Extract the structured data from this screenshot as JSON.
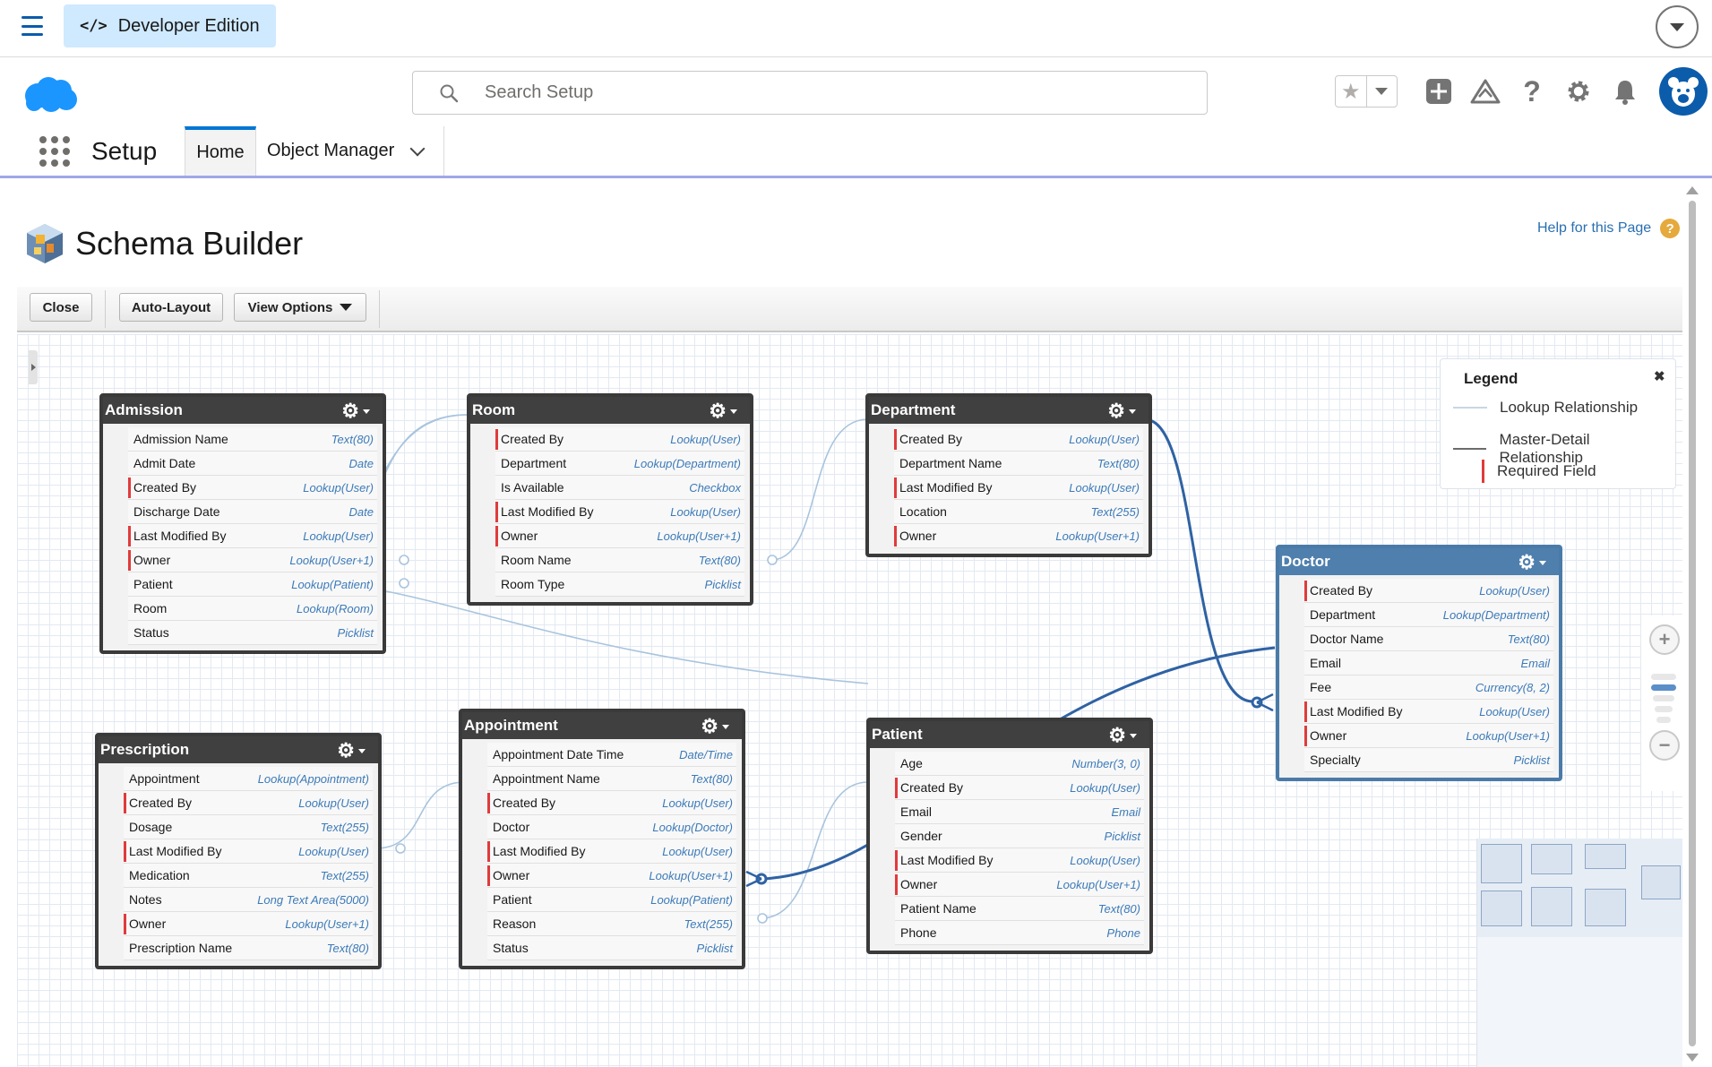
{
  "topbar": {
    "badge_label": "Developer Edition",
    "code_icon": "</>"
  },
  "search": {
    "placeholder": "Search Setup"
  },
  "nav": {
    "app_name": "Setup",
    "tabs": [
      {
        "label": "Home"
      },
      {
        "label": "Object Manager"
      }
    ]
  },
  "page": {
    "title": "Schema Builder",
    "help_link": "Help for this Page",
    "help_icon": "?",
    "buttons": {
      "close": "Close",
      "auto_layout": "Auto-Layout",
      "view_options": "View Options"
    }
  },
  "objects": {
    "admission": {
      "title": "Admission",
      "fields": [
        {
          "name": "Admission Name",
          "type": "Text(80)"
        },
        {
          "name": "Admit Date",
          "type": "Date"
        },
        {
          "name": "Created By",
          "type": "Lookup(User)",
          "required": true
        },
        {
          "name": "Discharge Date",
          "type": "Date"
        },
        {
          "name": "Last Modified By",
          "type": "Lookup(User)",
          "required": true
        },
        {
          "name": "Owner",
          "type": "Lookup(User+1)",
          "required": true
        },
        {
          "name": "Patient",
          "type": "Lookup(Patient)"
        },
        {
          "name": "Room",
          "type": "Lookup(Room)"
        },
        {
          "name": "Status",
          "type": "Picklist"
        }
      ]
    },
    "room": {
      "title": "Room",
      "fields": [
        {
          "name": "Created By",
          "type": "Lookup(User)",
          "required": true
        },
        {
          "name": "Department",
          "type": "Lookup(Department)"
        },
        {
          "name": "Is Available",
          "type": "Checkbox"
        },
        {
          "name": "Last Modified By",
          "type": "Lookup(User)",
          "required": true
        },
        {
          "name": "Owner",
          "type": "Lookup(User+1)",
          "required": true
        },
        {
          "name": "Room Name",
          "type": "Text(80)"
        },
        {
          "name": "Room Type",
          "type": "Picklist"
        }
      ]
    },
    "department": {
      "title": "Department",
      "fields": [
        {
          "name": "Created By",
          "type": "Lookup(User)",
          "required": true
        },
        {
          "name": "Department Name",
          "type": "Text(80)"
        },
        {
          "name": "Last Modified By",
          "type": "Lookup(User)",
          "required": true
        },
        {
          "name": "Location",
          "type": "Text(255)"
        },
        {
          "name": "Owner",
          "type": "Lookup(User+1)",
          "required": true
        }
      ]
    },
    "doctor": {
      "title": "Doctor",
      "fields": [
        {
          "name": "Created By",
          "type": "Lookup(User)",
          "required": true
        },
        {
          "name": "Department",
          "type": "Lookup(Department)"
        },
        {
          "name": "Doctor Name",
          "type": "Text(80)"
        },
        {
          "name": "Email",
          "type": "Email"
        },
        {
          "name": "Fee",
          "type": "Currency(8, 2)"
        },
        {
          "name": "Last Modified By",
          "type": "Lookup(User)",
          "required": true
        },
        {
          "name": "Owner",
          "type": "Lookup(User+1)",
          "required": true
        },
        {
          "name": "Specialty",
          "type": "Picklist"
        }
      ]
    },
    "prescription": {
      "title": "Prescription",
      "fields": [
        {
          "name": "Appointment",
          "type": "Lookup(Appointment)"
        },
        {
          "name": "Created By",
          "type": "Lookup(User)",
          "required": true
        },
        {
          "name": "Dosage",
          "type": "Text(255)"
        },
        {
          "name": "Last Modified By",
          "type": "Lookup(User)",
          "required": true
        },
        {
          "name": "Medication",
          "type": "Text(255)"
        },
        {
          "name": "Notes",
          "type": "Long Text Area(5000)"
        },
        {
          "name": "Owner",
          "type": "Lookup(User+1)",
          "required": true
        },
        {
          "name": "Prescription Name",
          "type": "Text(80)"
        }
      ]
    },
    "appointment": {
      "title": "Appointment",
      "fields": [
        {
          "name": "Appointment Date Time",
          "type": "Date/Time"
        },
        {
          "name": "Appointment Name",
          "type": "Text(80)"
        },
        {
          "name": "Created By",
          "type": "Lookup(User)",
          "required": true
        },
        {
          "name": "Doctor",
          "type": "Lookup(Doctor)"
        },
        {
          "name": "Last Modified By",
          "type": "Lookup(User)",
          "required": true
        },
        {
          "name": "Owner",
          "type": "Lookup(User+1)",
          "required": true
        },
        {
          "name": "Patient",
          "type": "Lookup(Patient)"
        },
        {
          "name": "Reason",
          "type": "Text(255)"
        },
        {
          "name": "Status",
          "type": "Picklist"
        }
      ]
    },
    "patient": {
      "title": "Patient",
      "fields": [
        {
          "name": "Age",
          "type": "Number(3, 0)"
        },
        {
          "name": "Created By",
          "type": "Lookup(User)",
          "required": true
        },
        {
          "name": "Email",
          "type": "Email"
        },
        {
          "name": "Gender",
          "type": "Picklist"
        },
        {
          "name": "Last Modified By",
          "type": "Lookup(User)",
          "required": true
        },
        {
          "name": "Owner",
          "type": "Lookup(User+1)",
          "required": true
        },
        {
          "name": "Patient Name",
          "type": "Text(80)"
        },
        {
          "name": "Phone",
          "type": "Phone"
        }
      ]
    }
  },
  "legend": {
    "title": "Legend",
    "close": "✖",
    "items": [
      {
        "label": "Lookup Relationship"
      },
      {
        "label": "Master-Detail Relationship"
      },
      {
        "label": "Required Field"
      }
    ],
    "colors": {
      "lookup": "#a9c4dd",
      "master_detail": "#6b6b6b",
      "required": "#e03b3b"
    }
  },
  "zoom": {
    "in": "+",
    "out": "−"
  },
  "colors": {
    "accent": "#0176d3",
    "badge_bg": "#cfe9fe",
    "object_header": "#404040",
    "selected_object_header": "#4f7fad",
    "master_detail_line": "#2f62a3"
  }
}
